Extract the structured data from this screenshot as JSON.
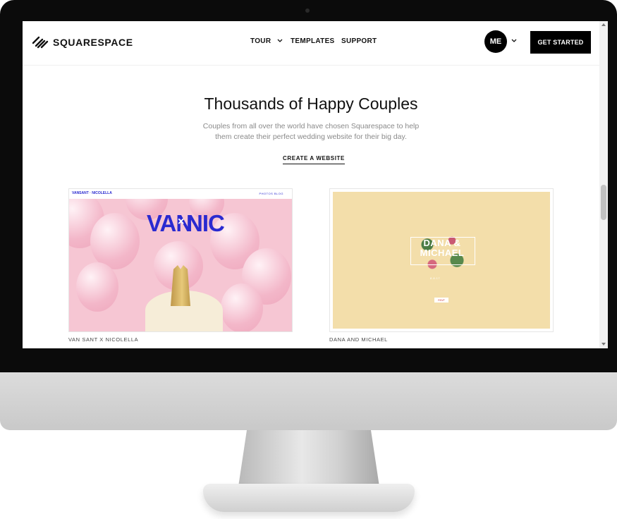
{
  "nav": {
    "logo_text": "SQUARESPACE",
    "tour": "TOUR",
    "templates": "TEMPLATES",
    "support": "SUPPORT",
    "avatar": "ME",
    "get_started": "GET STARTED"
  },
  "hero": {
    "title": "Thousands of Happy Couples",
    "subtitle": "Couples from all over the world have chosen Squarespace to help them create their perfect wedding website for their big day.",
    "cta": "CREATE A WEBSITE"
  },
  "cards": [
    {
      "caption": "VAN SANT X NICOLELLA",
      "mini_logo": "VANSANT · NICOLELLA",
      "mini_nav": "PHOTOS   BLOG",
      "headline_left": "VAN",
      "headline_x": "×",
      "headline_right": "NIC"
    },
    {
      "caption": "DANA AND MICHAEL",
      "headline": "DANA & MICHAEL",
      "date": "8.8.17",
      "rsvp": "RSVP"
    }
  ],
  "colors": {
    "accent_blue": "#2a2ad0",
    "pink_bg": "#f6c6d3",
    "yellow_bg": "#f3deaa"
  }
}
